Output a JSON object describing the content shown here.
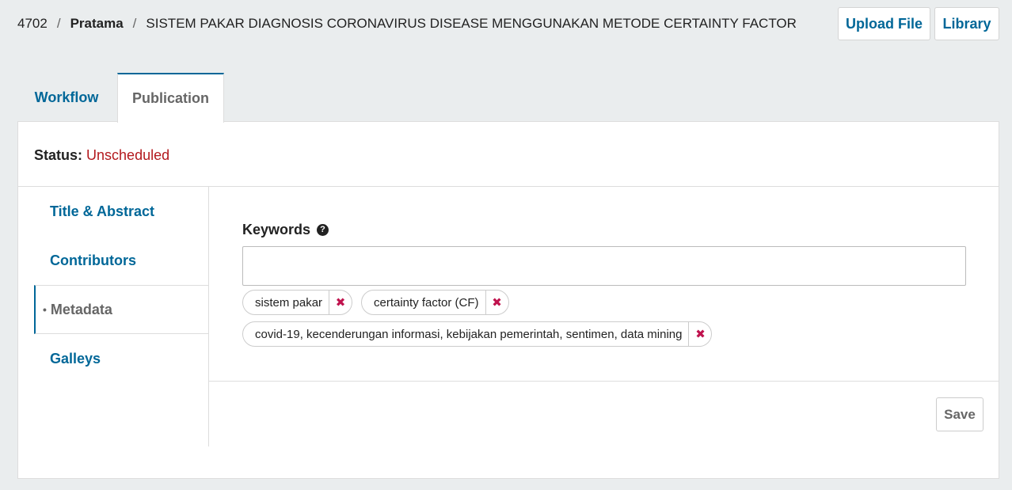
{
  "header": {
    "submission_id": "4702",
    "separator": "/",
    "author": "Pratama",
    "title": "SISTEM PAKAR DIAGNOSIS CORONAVIRUS DISEASE MENGGUNAKAN METODE CERTAINTY FACTOR",
    "upload_label": "Upload File",
    "library_label": "Library"
  },
  "tabs": [
    {
      "label": "Workflow",
      "active": false
    },
    {
      "label": "Publication",
      "active": true
    }
  ],
  "status": {
    "label": "Status:",
    "value": "Unscheduled"
  },
  "sidebar": {
    "items": [
      {
        "label": "Title & Abstract"
      },
      {
        "label": "Contributors"
      },
      {
        "label": "Metadata",
        "active": true
      },
      {
        "label": "Galleys"
      }
    ]
  },
  "keywords": {
    "label": "Keywords",
    "input_value": "",
    "tags": [
      "sistem pakar",
      "certainty factor (CF)",
      "covid-19, kecenderungan informasi, kebijakan pemerintah, sentimen, data mining"
    ]
  },
  "form": {
    "save_label": "Save"
  },
  "colors": {
    "accent": "#006798",
    "status_red": "#b3191e",
    "remove_x": "#c0134e"
  }
}
